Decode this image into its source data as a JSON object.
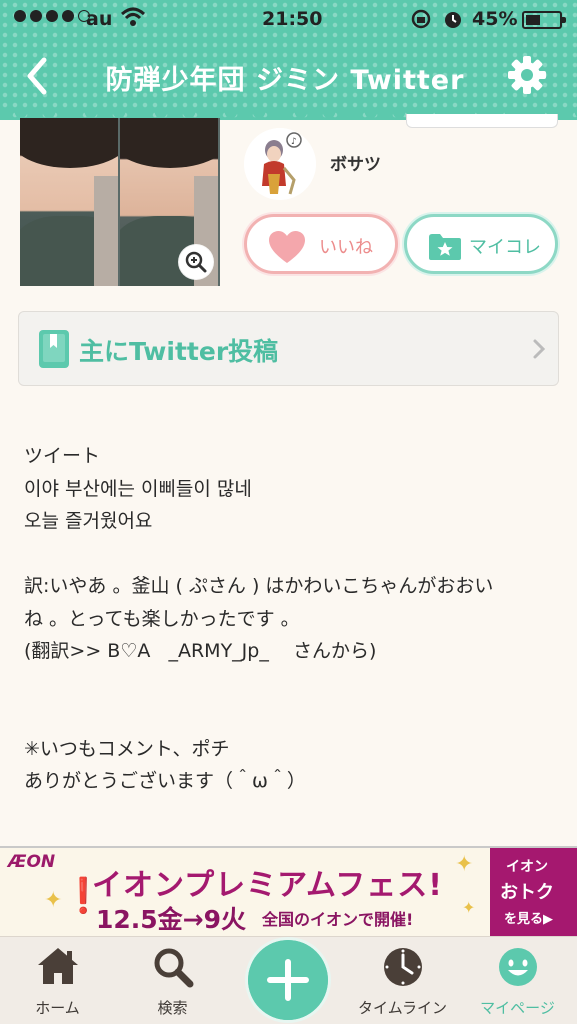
{
  "status_bar": {
    "carrier": "au",
    "time": "21:50",
    "battery": "45%",
    "battery_level": 0.45
  },
  "header": {
    "title": "防弾少年団  ジミン  Twitter"
  },
  "post": {
    "author": "ボサツ",
    "like_label": "いいね",
    "mycolle_label": "マイコレ",
    "category": "主にTwitter投稿",
    "body_lines": [
      "ツイート",
      "이야 부산에는 이삐들이 많네",
      "오늘 즐거웠어요",
      "",
      "訳:いやあ 。釜山 ( ぷさん ) はかわいこちゃんがおおい",
      "ね 。とっても楽しかったです 。",
      "(翻訳>> B♡A   _ARMY_Jp_    さんから)",
      "",
      "",
      "✳いつもコメント、ポチ",
      "ありがとうございます（＾ω＾）"
    ]
  },
  "ad": {
    "brand": "ÆON",
    "title": "イオンプレミアムフェス!",
    "dates": "12.5金→9火",
    "subtitle": "全国のイオンで開催!",
    "side_line1": "イオン",
    "side_line2": "おトク",
    "side_line3": "を見る▶"
  },
  "tab_bar": {
    "items": [
      {
        "label": "ホーム",
        "icon": "home-icon"
      },
      {
        "label": "検索",
        "icon": "search-icon"
      },
      {
        "label": "",
        "icon": "plus-icon"
      },
      {
        "label": "タイムライン",
        "icon": "clock-icon"
      },
      {
        "label": "マイページ",
        "icon": "smiley-icon"
      }
    ],
    "active": "マイページ"
  },
  "colors": {
    "accent": "#5cc9ad",
    "like": "#f2b2b2",
    "ad": "#a5186f"
  }
}
